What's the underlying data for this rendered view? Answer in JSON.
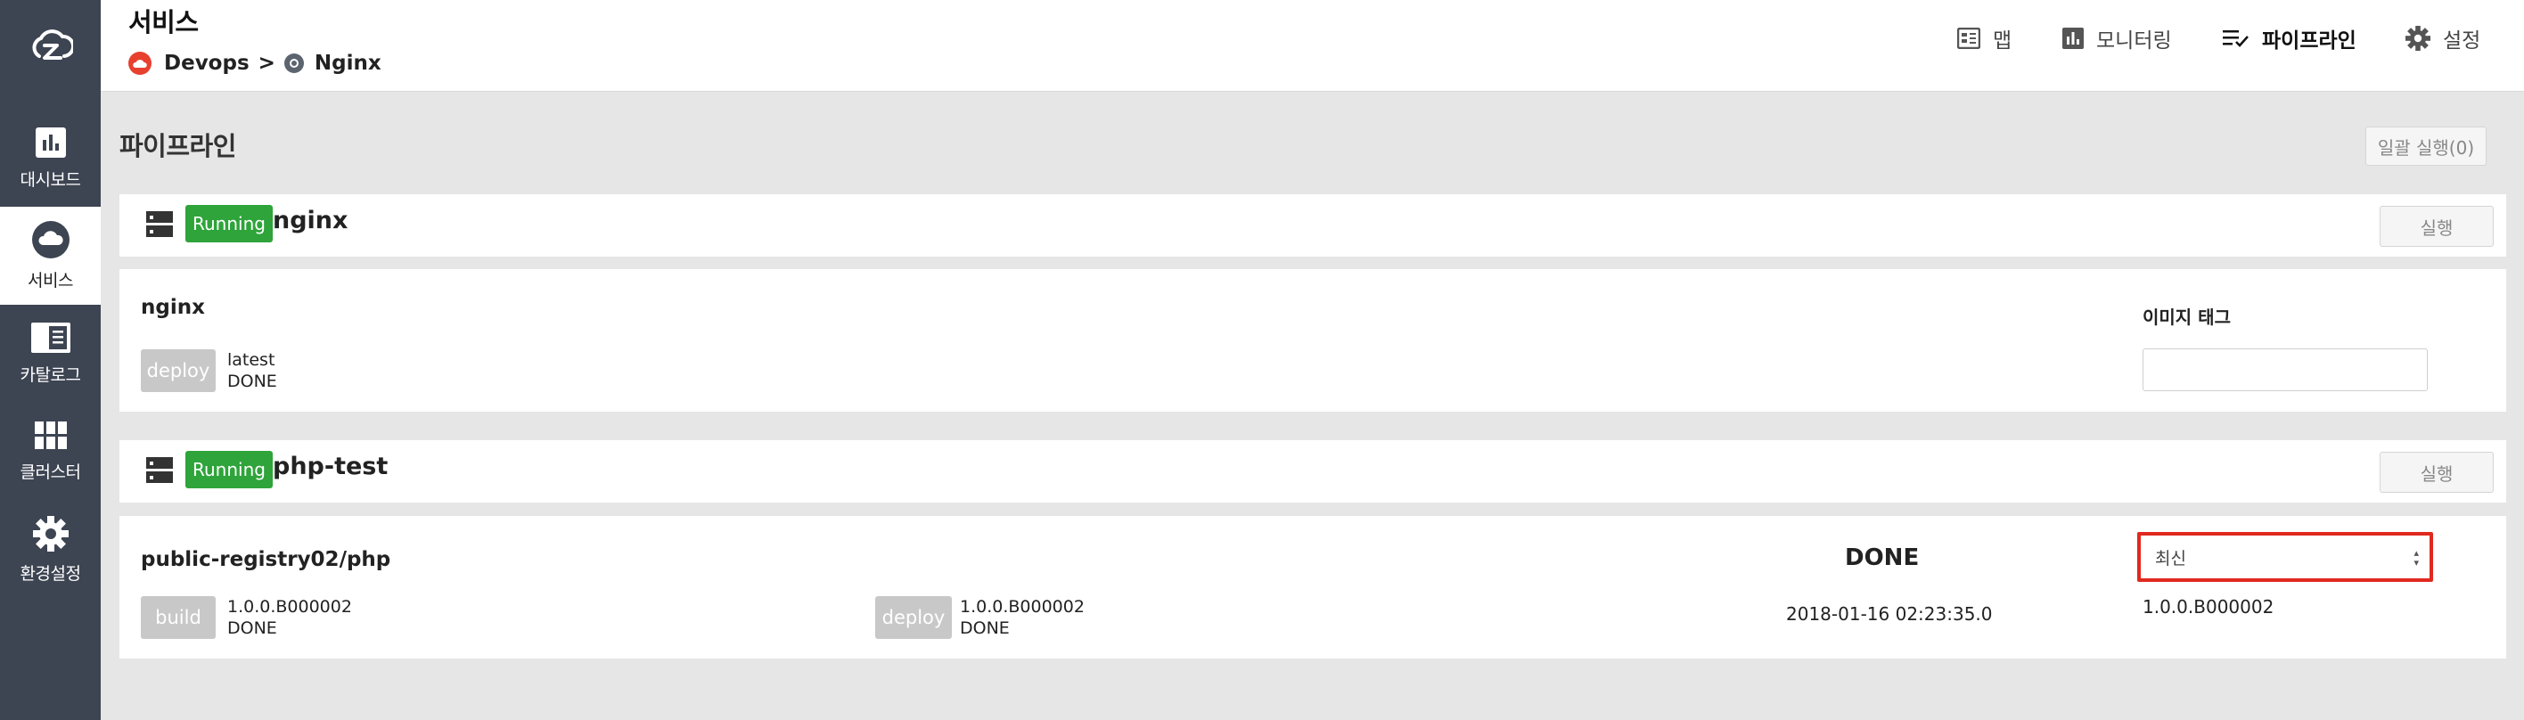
{
  "sidebar": {
    "items": [
      {
        "label": "대시보드",
        "icon": "dashboard-icon"
      },
      {
        "label": "서비스",
        "icon": "cloud-icon"
      },
      {
        "label": "카탈로그",
        "icon": "catalog-icon"
      },
      {
        "label": "클러스터",
        "icon": "grid-icon"
      },
      {
        "label": "환경설정",
        "icon": "gear-icon"
      }
    ]
  },
  "header": {
    "title": "서비스",
    "breadcrumb": {
      "project": "Devops",
      "separator": ">",
      "service": "Nginx"
    },
    "menu": {
      "map": "맵",
      "monitoring": "모니터링",
      "pipeline": "파이프라인",
      "settings": "설정"
    }
  },
  "main": {
    "title": "파이프라인",
    "batch_run_label": "일괄 실행(0)",
    "pipelines": [
      {
        "status": "Running",
        "name": "nginx",
        "run_label": "실행",
        "repo": "nginx",
        "stages": [
          {
            "label": "deploy",
            "tag": "latest",
            "status": "DONE"
          }
        ],
        "image_tag_label": "이미지 태그",
        "image_tag_value": ""
      },
      {
        "status": "Running",
        "name": "php-test",
        "run_label": "실행",
        "repo": "public-registry02/php",
        "stages": [
          {
            "label": "build",
            "tag": "1.0.0.B000002",
            "status": "DONE"
          },
          {
            "label": "deploy",
            "tag": "1.0.0.B000002",
            "status": "DONE"
          }
        ],
        "overall_status": "DONE",
        "timestamp": "2018-01-16 02:23:35.0",
        "select_value": "최신",
        "current_tag": "1.0.0.B000002"
      }
    ]
  },
  "colors": {
    "sidebar": "#3d4452",
    "running": "#2ea43a",
    "highlight": "#e0291f",
    "accent_cloud": "#e8402f"
  }
}
